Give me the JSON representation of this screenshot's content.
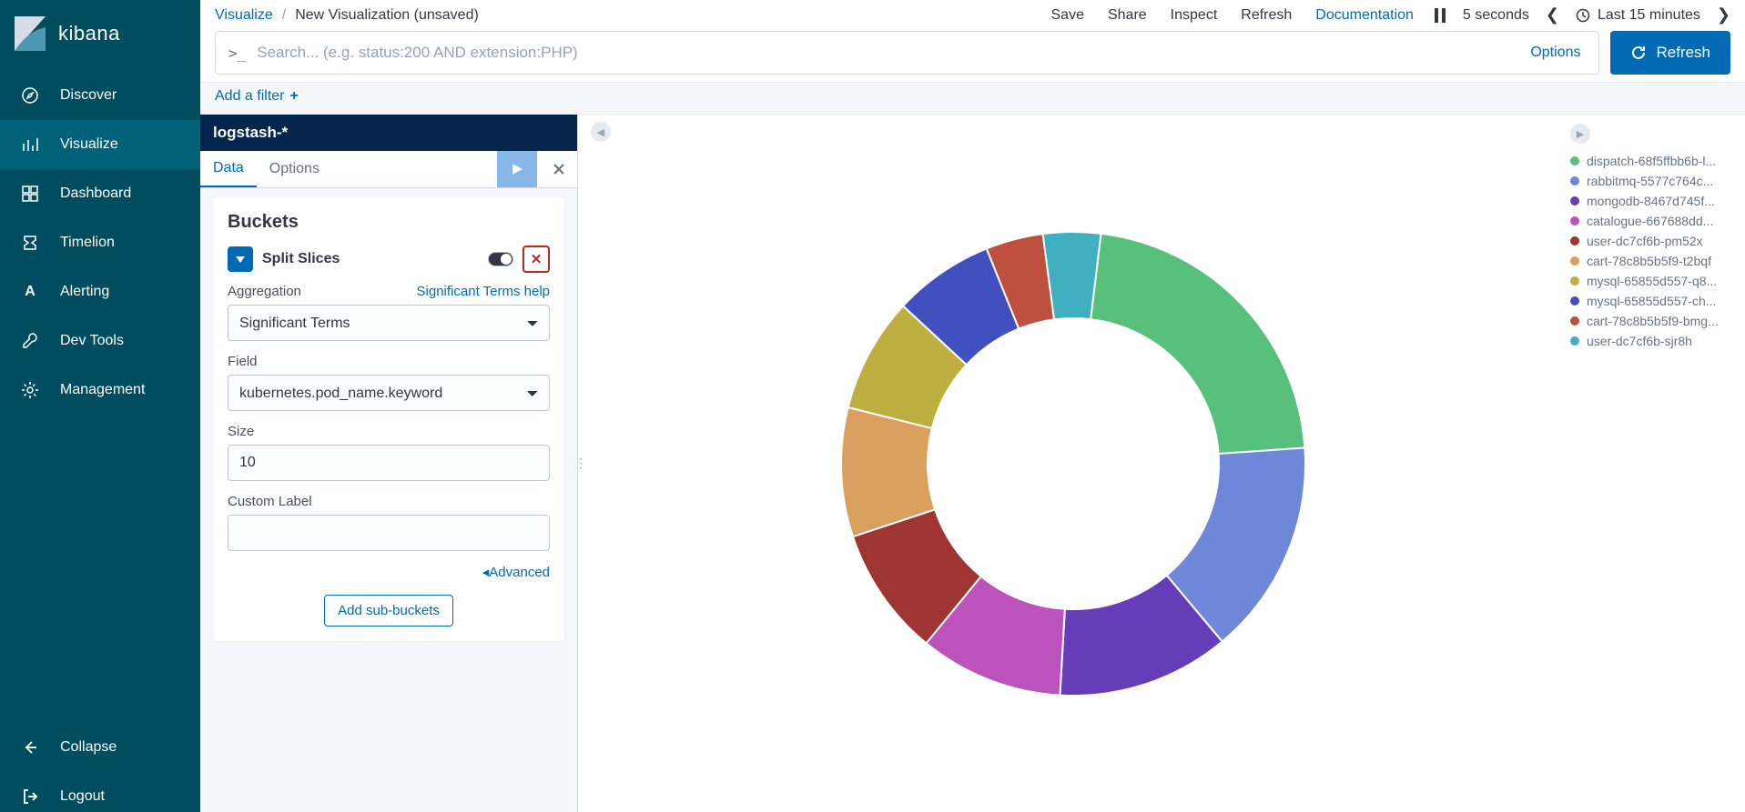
{
  "app": {
    "name": "kibana"
  },
  "sidebar": {
    "items": [
      {
        "label": "Discover"
      },
      {
        "label": "Visualize"
      },
      {
        "label": "Dashboard"
      },
      {
        "label": "Timelion"
      },
      {
        "label": "Alerting"
      },
      {
        "label": "Dev Tools"
      },
      {
        "label": "Management"
      }
    ],
    "collapse": "Collapse",
    "logout": "Logout"
  },
  "breadcrumb": {
    "root": "Visualize",
    "current": "New Visualization (unsaved)"
  },
  "top": {
    "save": "Save",
    "share": "Share",
    "inspect": "Inspect",
    "refresh": "Refresh",
    "documentation": "Documentation",
    "interval": "5 seconds",
    "range": "Last 15 minutes"
  },
  "search": {
    "placeholder": "Search... (e.g. status:200 AND extension:PHP)",
    "options": "Options",
    "refresh": "Refresh"
  },
  "filter": {
    "add": "Add a filter"
  },
  "editor": {
    "index": "logstash-*",
    "tabs": {
      "data": "Data",
      "options": "Options"
    },
    "buckets_title": "Buckets",
    "split_label": "Split Slices",
    "aggregation_label": "Aggregation",
    "aggregation_help": "Significant Terms help",
    "aggregation_value": "Significant Terms",
    "field_label": "Field",
    "field_value": "kubernetes.pod_name.keyword",
    "size_label": "Size",
    "size_value": "10",
    "custom_label": "Custom Label",
    "custom_value": "",
    "advanced": "Advanced",
    "add_sub": "Add sub-buckets"
  },
  "chart_data": {
    "type": "pie",
    "donut": true,
    "series": [
      {
        "name": "dispatch-68f5ffbb6b-l...",
        "value": 22,
        "color": "#57c17b"
      },
      {
        "name": "rabbitmq-5577c764c...",
        "value": 15,
        "color": "#6f87d8"
      },
      {
        "name": "mongodb-8467d745f...",
        "value": 12,
        "color": "#663db8"
      },
      {
        "name": "catalogue-667688dd...",
        "value": 10,
        "color": "#bc52bc"
      },
      {
        "name": "user-dc7cf6b-pm52x",
        "value": 9,
        "color": "#9e3533"
      },
      {
        "name": "cart-78c8b5b5f9-t2bqf",
        "value": 9,
        "color": "#daa05d"
      },
      {
        "name": "mysql-65855d557-q8...",
        "value": 8,
        "color": "#bfaf40"
      },
      {
        "name": "mysql-65855d557-ch...",
        "value": 7,
        "color": "#4050bf"
      },
      {
        "name": "cart-78c8b5b5f9-bmg...",
        "value": 4,
        "color": "#bf5040"
      },
      {
        "name": "user-dc7cf6b-sjr8h",
        "value": 4,
        "color": "#40afbf"
      }
    ]
  }
}
